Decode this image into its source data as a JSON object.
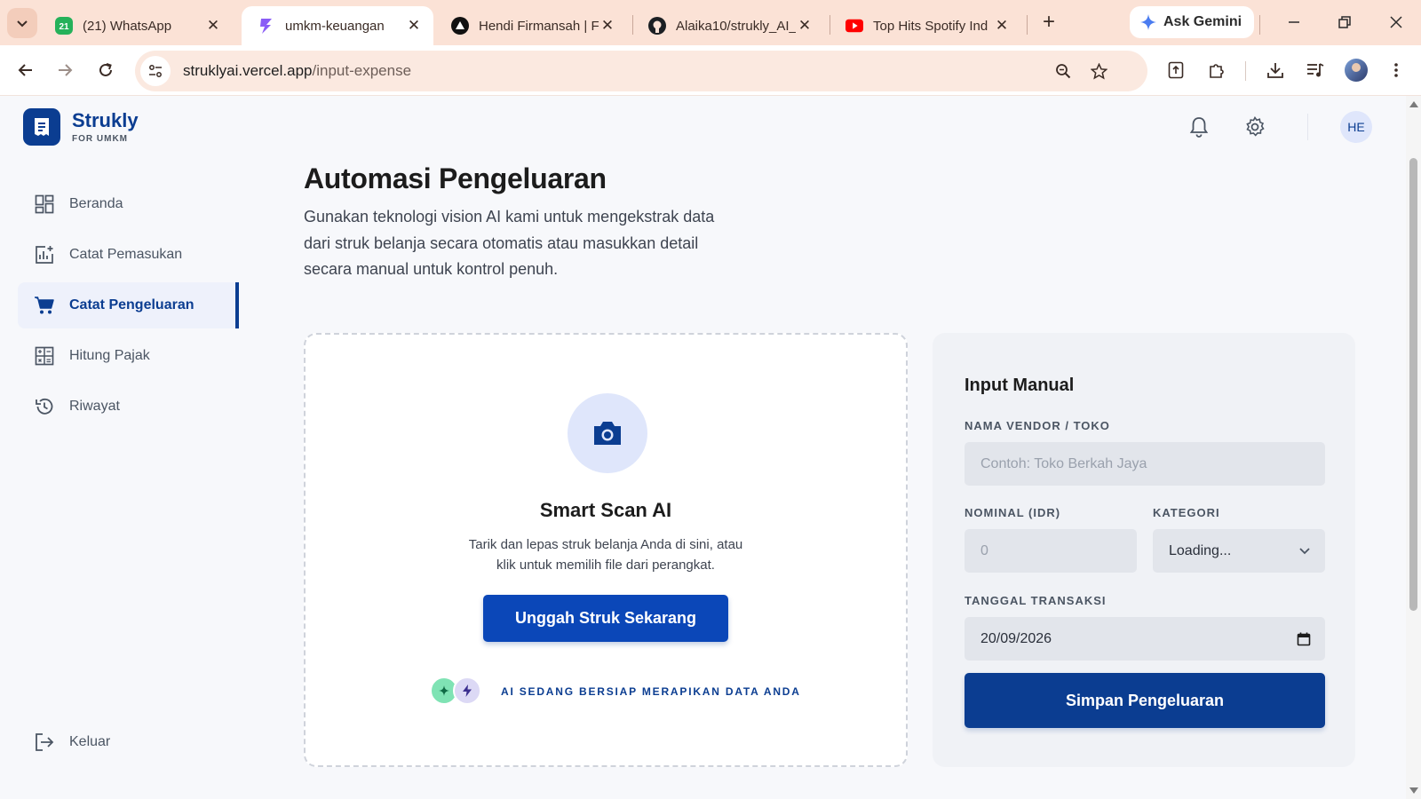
{
  "browser": {
    "tabs": [
      {
        "title": "(21) WhatsApp",
        "badge": "21",
        "icon": "whatsapp-icon"
      },
      {
        "title": "umkm-keuangan",
        "icon": "bolt-icon",
        "active": true
      },
      {
        "title": "Hendi Firmansah | F",
        "icon": "triangle-icon"
      },
      {
        "title": "Alaika10/strukly_AI_",
        "icon": "github-icon"
      },
      {
        "title": "Top Hits Spotify Ind",
        "icon": "youtube-icon"
      }
    ],
    "new_tab_symbol": "+",
    "gemini_label": "Ask Gemini",
    "url_host": "struklyai.vercel.app",
    "url_path": "/input-expense"
  },
  "app": {
    "logo_name": "Strukly",
    "logo_sub": "FOR UMKM",
    "avatar_initials": "HE",
    "brand_color": "#0b3d91"
  },
  "sidebar": {
    "items": [
      {
        "label": "Beranda",
        "icon": "dashboard-icon"
      },
      {
        "label": "Catat Pemasukan",
        "icon": "chart-add-icon"
      },
      {
        "label": "Catat Pengeluaran",
        "icon": "cart-icon",
        "active": true
      },
      {
        "label": "Hitung Pajak",
        "icon": "calculator-icon"
      },
      {
        "label": "Riwayat",
        "icon": "history-icon"
      }
    ],
    "logout": {
      "label": "Keluar",
      "icon": "logout-icon"
    }
  },
  "main": {
    "title": "Automasi Pengeluaran",
    "description_lines": [
      "Gunakan teknologi vision AI kami untuk mengekstrak data",
      "dari struk belanja secara otomatis atau masukkan detail",
      "secara manual untuk kontrol penuh."
    ],
    "scan": {
      "title": "Smart Scan AI",
      "desc_lines": [
        "Tarik dan lepas struk belanja Anda di sini, atau",
        "klik untuk memilih file dari perangkat."
      ],
      "button": "Unggah Struk Sekarang",
      "status": "AI SEDANG BERSIAP MERAPIKAN DATA ANDA"
    },
    "manual": {
      "title": "Input Manual",
      "vendor_label": "NAMA VENDOR / TOKO",
      "vendor_placeholder": "Contoh: Toko Berkah Jaya",
      "nominal_label": "NOMINAL (IDR)",
      "nominal_placeholder": "0",
      "category_label": "KATEGORI",
      "category_value": "Loading...",
      "date_label": "TANGGAL TRANSAKSI",
      "date_value": "20/09/2026",
      "save_button": "Simpan Pengeluaran"
    }
  }
}
